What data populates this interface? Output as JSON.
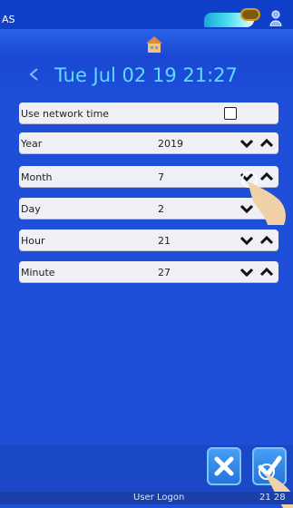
{
  "status": {
    "left_text": "AS"
  },
  "header": {
    "date_time": "Tue Jul 02 19 21:27"
  },
  "network_time": {
    "label": "Use network time",
    "checked": false
  },
  "fields": [
    {
      "label": "Year",
      "value": "2019"
    },
    {
      "label": "Month",
      "value": "7"
    },
    {
      "label": "Day",
      "value": "2"
    },
    {
      "label": "Hour",
      "value": "21"
    },
    {
      "label": "Minute",
      "value": "27"
    }
  ],
  "footer": {
    "user": "User Logon",
    "time": "21 28"
  },
  "colors": {
    "background": "#1f4fd8",
    "title_text": "#5fd9ff",
    "row_background": "#eef0f6",
    "button": "#2272d8"
  },
  "icons": [
    "home-icon",
    "back-chevron-icon",
    "chevron-down-icon",
    "chevron-up-icon",
    "cancel-icon",
    "confirm-icon",
    "tape-icon",
    "person-icon"
  ]
}
